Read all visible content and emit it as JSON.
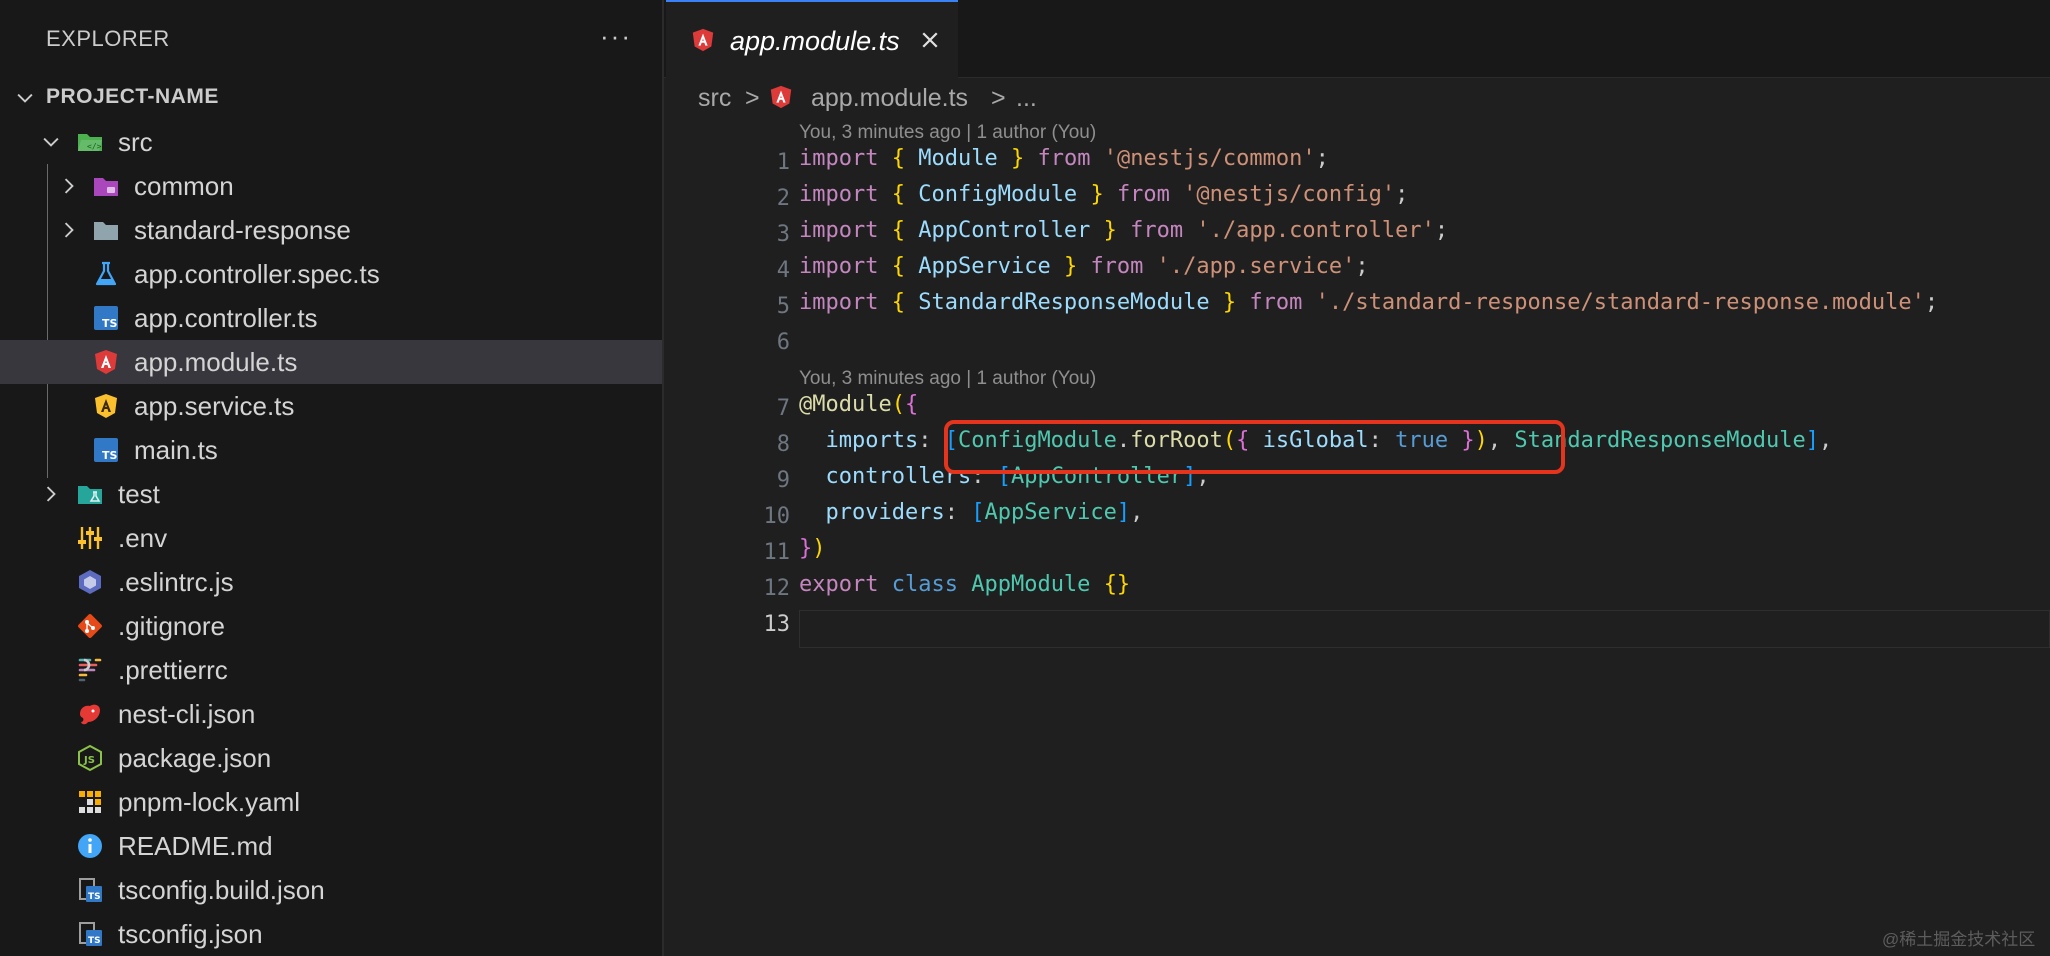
{
  "explorer": {
    "title": "EXPLORER",
    "more_icon": "ellipsis-icon",
    "project_name": "PROJECT-NAME",
    "items": [
      {
        "label": "src",
        "icon": "folder-src-open-icon"
      },
      {
        "label": "common",
        "icon": "folder-common-icon"
      },
      {
        "label": "standard-response",
        "icon": "folder-icon"
      },
      {
        "label": "app.controller.spec.ts",
        "icon": "test-flask-icon"
      },
      {
        "label": "app.controller.ts",
        "icon": "typescript-icon"
      },
      {
        "label": "app.module.ts",
        "icon": "angular-module-icon",
        "selected": true
      },
      {
        "label": "app.service.ts",
        "icon": "angular-service-icon"
      },
      {
        "label": "main.ts",
        "icon": "typescript-icon"
      },
      {
        "label": "test",
        "icon": "folder-test-icon"
      },
      {
        "label": ".env",
        "icon": "env-settings-icon"
      },
      {
        "label": ".eslintrc.js",
        "icon": "eslint-icon"
      },
      {
        "label": ".gitignore",
        "icon": "git-icon"
      },
      {
        "label": ".prettierrc",
        "icon": "prettier-icon"
      },
      {
        "label": "nest-cli.json",
        "icon": "nest-icon"
      },
      {
        "label": "package.json",
        "icon": "nodejs-icon"
      },
      {
        "label": "pnpm-lock.yaml",
        "icon": "pnpm-icon"
      },
      {
        "label": "README.md",
        "icon": "info-icon"
      },
      {
        "label": "tsconfig.build.json",
        "icon": "tsconfig-icon"
      },
      {
        "label": "tsconfig.json",
        "icon": "tsconfig-icon"
      }
    ]
  },
  "editor": {
    "tab": {
      "label": "app.module.ts",
      "icon": "angular-module-icon",
      "close_icon": "close-icon"
    },
    "breadcrumb": {
      "folder": "src",
      "separator": ">",
      "file": "app.module.ts",
      "more": "..."
    },
    "blame": [
      "You, 3 minutes ago | 1 author (You)",
      "You, 3 minutes ago | 1 author (You)"
    ],
    "line_numbers": [
      "1",
      "2",
      "3",
      "4",
      "5",
      "6",
      "7",
      "8",
      "9",
      "10",
      "11",
      "12",
      "13"
    ],
    "current_line": "13",
    "code": {
      "import_kw": "import",
      "from_kw": "from",
      "lb": "{",
      "rb": "}",
      "semi": ";",
      "l1_name": "Module",
      "l1_src": "'@nestjs/common'",
      "l2_name": "ConfigModule",
      "l2_src": "'@nestjs/config'",
      "l3_name": "AppController",
      "l3_src": "'./app.controller'",
      "l4_name": "AppService",
      "l4_src": "'./app.service'",
      "l5_name": "StandardResponseModule",
      "l5_src": "'./standard-response/standard-response.module'",
      "decorator": "@Module",
      "lp": "(",
      "rp": ")",
      "lsq": "[",
      "rsq": "]",
      "colon": ":",
      "comma": ",",
      "dot": ".",
      "imports_key": "imports",
      "config_module": "ConfigModule",
      "for_root": "forRoot",
      "is_global": "isGlobal",
      "true_kw": "true",
      "std_module": "StandardResponseModule",
      "controllers_key": "controllers",
      "app_controller": "AppController",
      "providers_key": "providers",
      "app_service": "AppService",
      "export_kw": "export",
      "class_kw": "class",
      "app_module": "AppModule",
      "empty_braces": "{}"
    },
    "highlight_color": "#e5341d"
  },
  "watermark": "@稀土掘金技术社区"
}
